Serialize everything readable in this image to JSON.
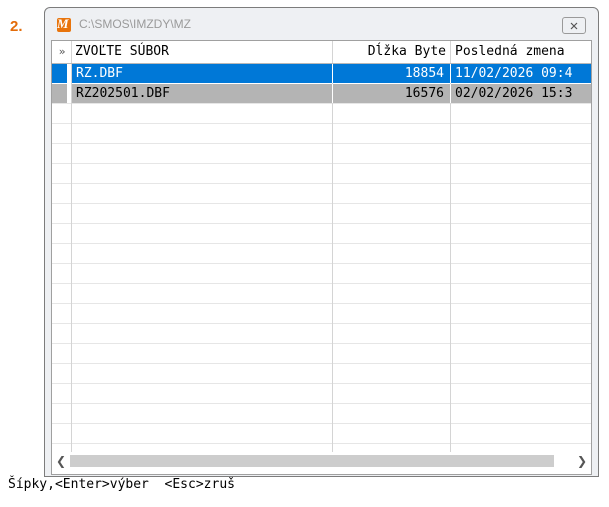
{
  "step_label": "2.",
  "window": {
    "title": "C:\\SMOS\\IMZDY\\MZ",
    "app_icon_letter": "M"
  },
  "grid": {
    "header": {
      "marker": "»",
      "name": "ZVOĽTE SÚBOR",
      "size": "Dĺžka Byte",
      "modified": "Posledná zmena"
    },
    "rows": [
      {
        "name": "RZ.DBF",
        "size": "18854",
        "modified": "11/02/2026 09:4"
      },
      {
        "name": "RZ202501.DBF",
        "size": "16576",
        "modified": "02/02/2026 15:3"
      }
    ]
  },
  "colors": {
    "selected_row": "#0078d7",
    "normal_row": "#b4b4b4",
    "step_label": "#e36c0a",
    "app_icon": "#e8740c"
  },
  "status_bar": "Šípky,<Enter>výber  <Esc>zruš"
}
